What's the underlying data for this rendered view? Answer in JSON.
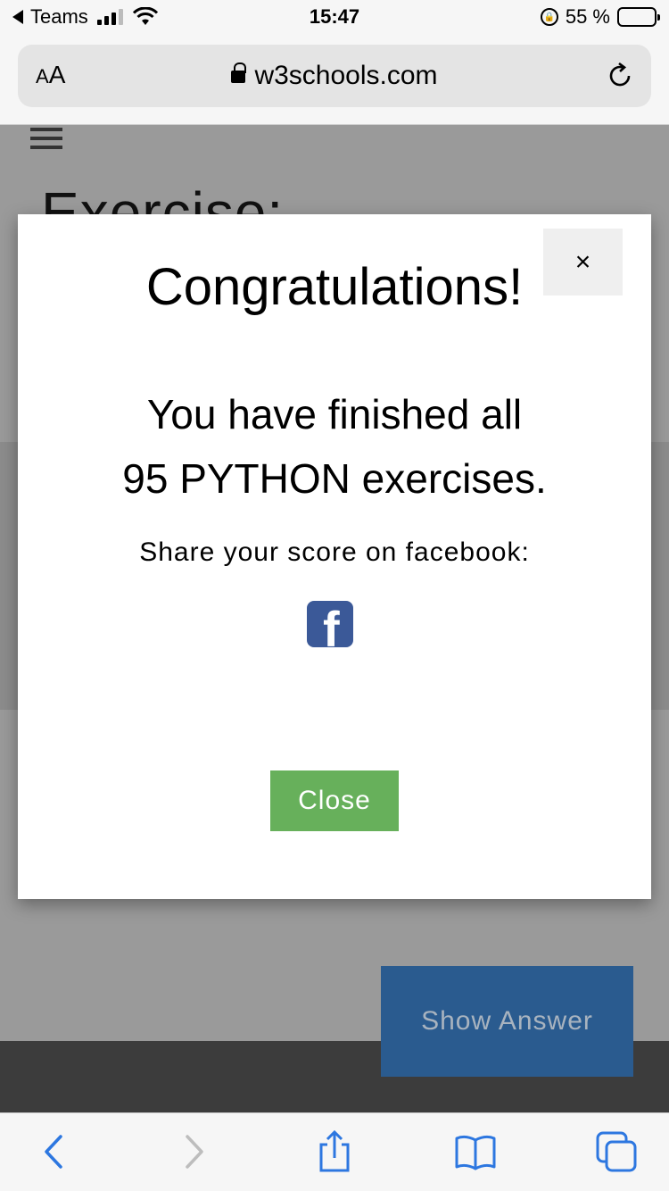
{
  "status_bar": {
    "back_app": "Teams",
    "time": "15:47",
    "battery": "55 %",
    "battery_level": 0.55
  },
  "browser": {
    "text_size_label_small": "A",
    "text_size_label_large": "A",
    "url": "w3schools.com"
  },
  "page": {
    "heading": "Exercise:",
    "show_answer": "Show Answer"
  },
  "modal": {
    "title": "Congratulations!",
    "close_x": "×",
    "message_line1": "You have finished all",
    "message_line2": "95 PYTHON exercises.",
    "share_text": "Share your score on facebook:",
    "close_button": "Close"
  },
  "toolbar": {
    "items": [
      "back-icon",
      "forward-icon",
      "share-icon",
      "bookmarks-icon",
      "tabs-icon"
    ]
  },
  "colors": {
    "accent_blue": "#2d77e0",
    "close_green": "#67b05b",
    "facebook_blue": "#3b5998",
    "show_answer_blue": "#2a5b8f"
  }
}
